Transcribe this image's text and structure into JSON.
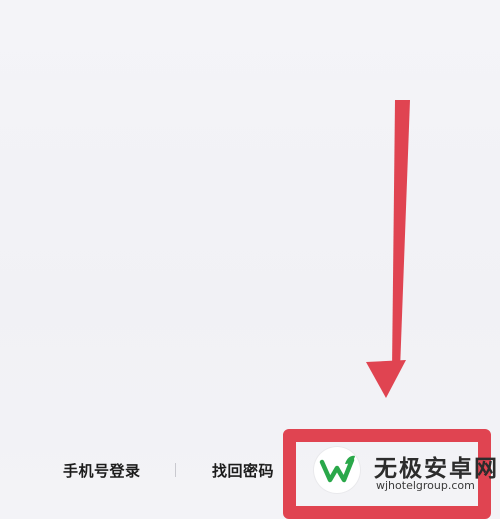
{
  "bottom_links": {
    "phone_login": "手机号登录",
    "recover_password": "找回密码"
  },
  "watermark": {
    "title": "无极安卓网",
    "url": "wjhotelgroup.com",
    "logo_icon": "w-leaf-logo-icon"
  },
  "colors": {
    "annotation_red": "#e04451",
    "logo_green": "#2aa84a"
  }
}
